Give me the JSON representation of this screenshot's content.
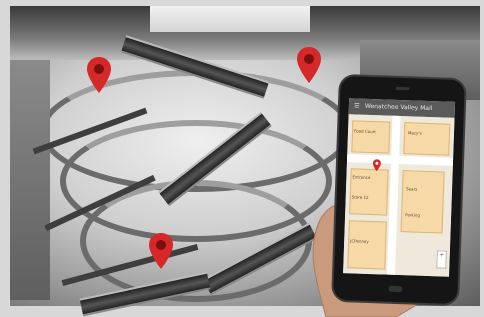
{
  "scene": {
    "subject": "shopping-mall-atrium-indoor-navigation"
  },
  "pins": [
    {
      "name": "map-pin-left",
      "color": "#d62828"
    },
    {
      "name": "map-pin-right",
      "color": "#d62828"
    },
    {
      "name": "map-pin-bottom",
      "color": "#d62828"
    }
  ],
  "phone": {
    "app_bar_back": "☰",
    "app_bar_title": "Wenatchee Valley Mall",
    "map_labels": [
      "Food Court",
      "Macy's",
      "Entrance",
      "Sears",
      "Store 12",
      "Parking",
      "JCPenney"
    ],
    "zoom_glyph": "+",
    "accent_color": "#d62828"
  }
}
